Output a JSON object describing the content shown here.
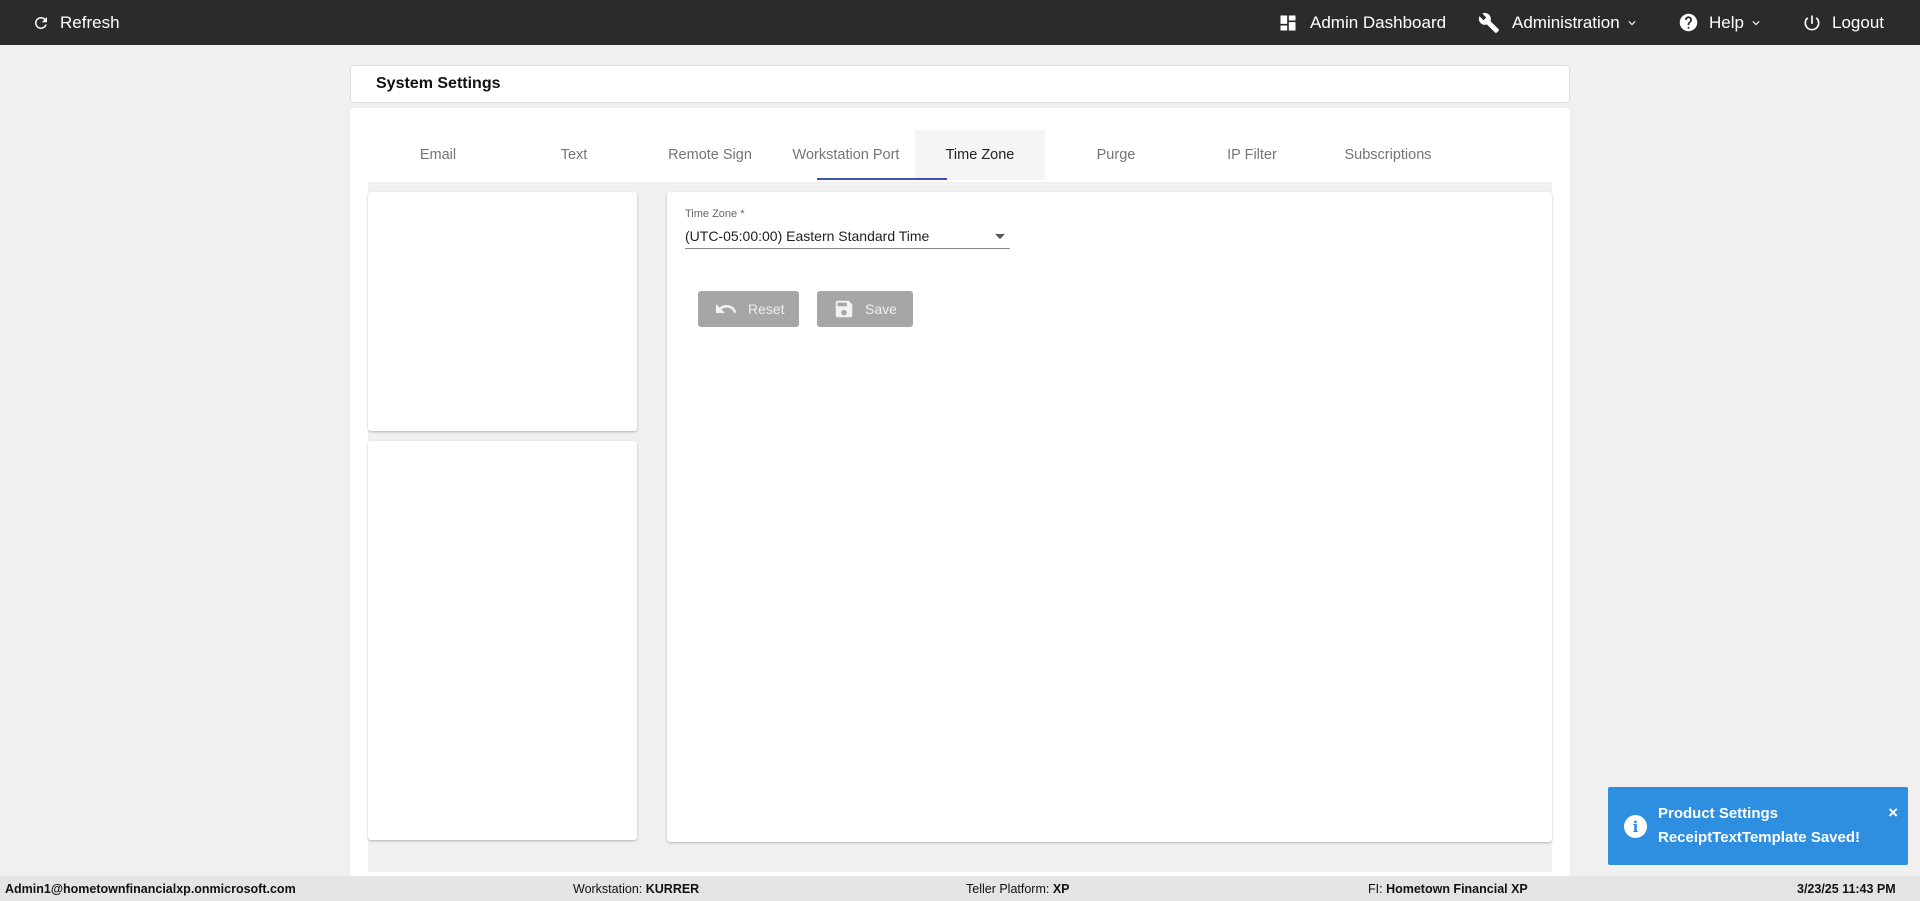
{
  "topbar": {
    "refresh_label": "Refresh",
    "dashboard_label": "Admin Dashboard",
    "administration_label": "Administration",
    "help_label": "Help",
    "logout_label": "Logout"
  },
  "page": {
    "title": "System Settings"
  },
  "tabs": [
    {
      "label": "Email"
    },
    {
      "label": "Text"
    },
    {
      "label": "Remote Sign"
    },
    {
      "label": "Workstation Port"
    },
    {
      "label": "Time Zone",
      "active": true
    },
    {
      "label": "Purge"
    },
    {
      "label": "IP Filter"
    },
    {
      "label": "Subscriptions"
    }
  ],
  "timezone": {
    "label": "Time Zone *",
    "value": "(UTC-05:00:00) Eastern Standard Time"
  },
  "buttons": {
    "reset_label": "Reset",
    "save_label": "Save"
  },
  "toast": {
    "title": "Product Settings",
    "message": "ReceiptTextTemplate Saved!",
    "close_glyph": "×",
    "icon_glyph": "i",
    "color": "#2e8ee0"
  },
  "statusbar": {
    "user": "Admin1@hometownfinancialxp.onmicrosoft.com",
    "workstation_label": "Workstation:",
    "workstation_value": "KURRER",
    "teller_label": "Teller Platform:",
    "teller_value": "XP",
    "fi_label": "FI:",
    "fi_value": "Hometown Financial XP",
    "datetime": "3/23/25 11:43 PM"
  },
  "colors": {
    "topbar": "#2b2b2b",
    "tab_indicator": "#3f51b5",
    "button_disabled": "#a6a6a6"
  }
}
